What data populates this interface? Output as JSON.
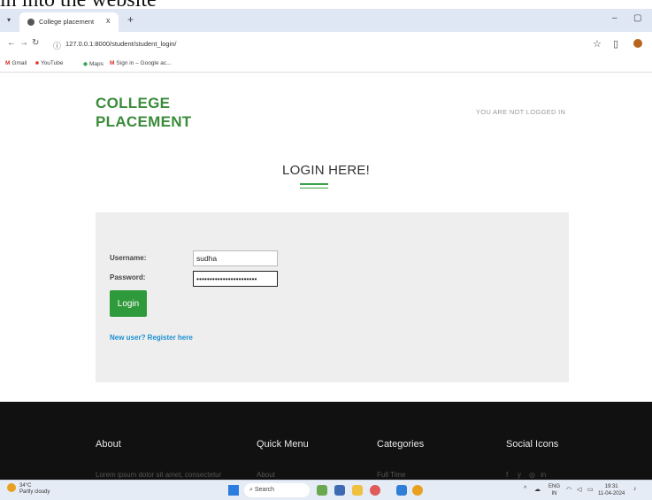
{
  "caption": "in into the website",
  "browser": {
    "tab_title": "College placement",
    "new_tab": "+",
    "close_tab": "x",
    "url": "127.0.0.1:8000/student/student_login/",
    "window_controls": [
      "–",
      "▢"
    ],
    "bookmarks": [
      {
        "icon": "M",
        "label": "Gmail",
        "color": "#d93025"
      },
      {
        "icon": "■",
        "label": "YouTube",
        "color": "#e62117"
      },
      {
        "icon": "◆",
        "label": "Maps",
        "color": "#34a853"
      },
      {
        "icon": "M",
        "label": "Sign in – Google ac...",
        "color": "#d93025"
      }
    ]
  },
  "header": {
    "logo_line1": "COLLEGE",
    "logo_line2": "PLACEMENT",
    "status": "YOU ARE NOT LOGGED IN"
  },
  "login": {
    "heading": "LOGIN HERE!",
    "username_label": "Username:",
    "username_value": "sudha",
    "password_label": "Password:",
    "password_value": "•••••••••••••••••••••••",
    "login_button": "Login",
    "register_link": "New user? Register here"
  },
  "footer": {
    "about": "About",
    "about_text": "Lorem ipsum dolor sit amet, consectetur",
    "quick_menu": "Quick Menu",
    "quick_menu_item": "About",
    "categories": "Categories",
    "categories_item": "Full Time",
    "social": "Social Icons",
    "social_icons": [
      "f",
      "y",
      "◎",
      "in"
    ]
  },
  "taskbar": {
    "temp": "34°C",
    "weather": "Partly cloudy",
    "search": "Search",
    "lang_top": "ENG",
    "lang_bottom": "IN",
    "time": "19:31",
    "date": "11-04-2024"
  },
  "colors": {
    "brand_green": "#3a8c3a",
    "button_green": "#2f9a3c",
    "link_blue": "#1a8fd1",
    "footer_bg": "#111111"
  }
}
